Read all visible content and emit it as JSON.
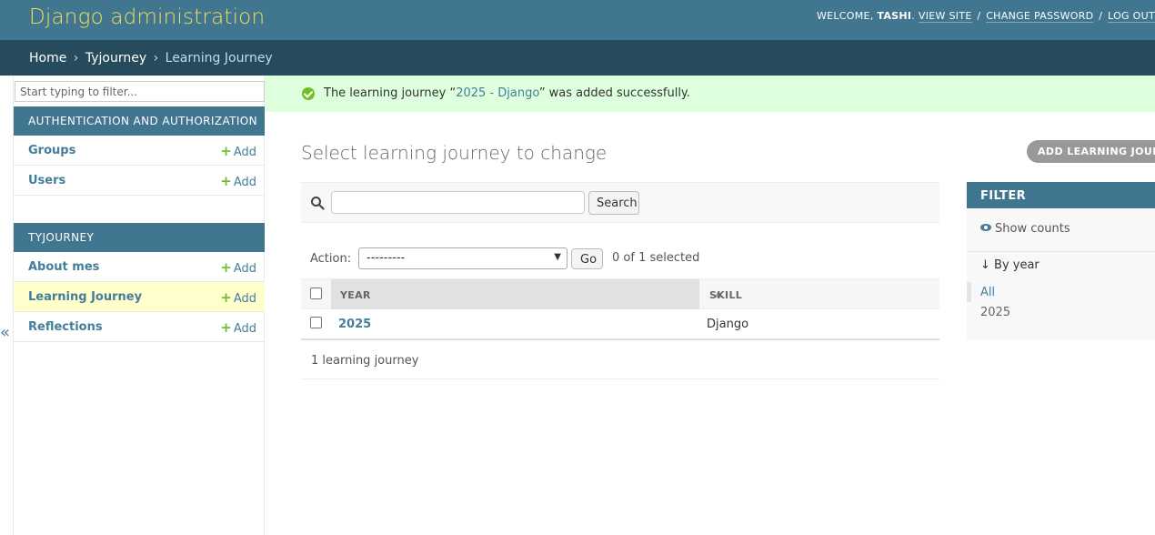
{
  "header": {
    "branding": "Django administration",
    "welcome": "WELCOME,",
    "username": "TASHI",
    "view_site": "VIEW SITE",
    "change_password": "CHANGE PASSWORD",
    "log_out": "LOG OUT",
    "separator": "/"
  },
  "breadcrumbs": {
    "home": "Home",
    "app": "Tyjourney",
    "current": "Learning Journey",
    "separator": "›"
  },
  "sidebar": {
    "toggle": "«",
    "filter_placeholder": "Start typing to filter...",
    "modules": [
      {
        "caption": "AUTHENTICATION AND AUTHORIZATION",
        "items": [
          {
            "label": "Groups",
            "add": "Add"
          },
          {
            "label": "Users",
            "add": "Add"
          }
        ]
      },
      {
        "caption": "TYJOURNEY",
        "items": [
          {
            "label": "About mes",
            "add": "Add"
          },
          {
            "label": "Learning Journey",
            "add": "Add",
            "current": true
          },
          {
            "label": "Reflections",
            "add": "Add"
          }
        ]
      }
    ]
  },
  "message": {
    "prefix": "The learning journey “",
    "link": "2025 - Django",
    "suffix": "” was added successfully."
  },
  "content": {
    "title": "Select learning journey to change",
    "add_button": "ADD LEARNING JOURNEY +",
    "search_button": "Search",
    "action_label": "Action:",
    "action_value": "---------",
    "go_button": "Go",
    "selected_count": "0 of 1 selected",
    "columns": [
      "YEAR",
      "SKILL"
    ],
    "rows": [
      {
        "year": "2025",
        "skill": "Django"
      }
    ],
    "paginator": "1 learning journey"
  },
  "filter": {
    "title": "FILTER",
    "show_counts": "Show counts",
    "by_year": "↓ By year",
    "options": [
      "All",
      "2025"
    ]
  },
  "colors": {
    "header": "#417690",
    "breadcrumbs": "#264b5d",
    "branding": "#f5dd5d",
    "success": "#dfd",
    "link": "#447e9b",
    "add_green": "#70bf2b",
    "current_row": "#ffffcc"
  }
}
